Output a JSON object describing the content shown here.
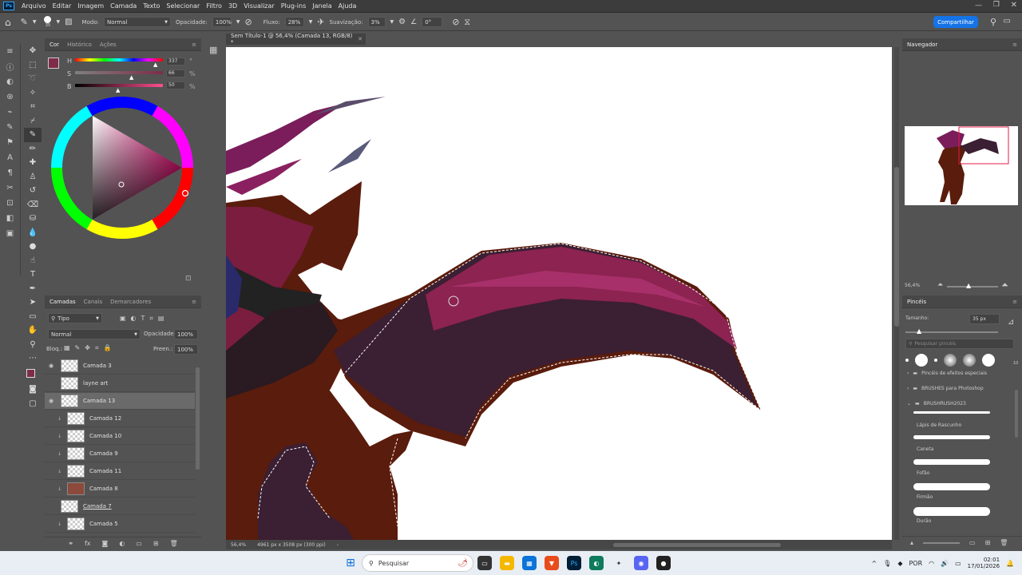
{
  "menu": [
    "Arquivo",
    "Editar",
    "Imagem",
    "Camada",
    "Texto",
    "Selecionar",
    "Filtro",
    "3D",
    "Visualizar",
    "Plug-ins",
    "Janela",
    "Ajuda"
  ],
  "options": {
    "brush_size": "35",
    "mode_label": "Modo:",
    "mode_value": "Normal",
    "opacity_label": "Opacidade:",
    "opacity_value": "100%",
    "flow_label": "Fluxo:",
    "flow_value": "28%",
    "smoothing_label": "Suavização:",
    "smoothing_value": "3%",
    "angle_value": "0°",
    "share_label": "Compartilhar"
  },
  "color_panel": {
    "tabs": [
      "Cor",
      "Histórico",
      "Ações"
    ],
    "h_label": "H",
    "h_value": "337",
    "h_unit": "°",
    "s_label": "S",
    "s_value": "66",
    "s_unit": "%",
    "b_label": "B",
    "b_value": "50",
    "b_unit": "%",
    "fg_color": "#7f2b4a",
    "bg_color": "#ffffff"
  },
  "layers_panel": {
    "tabs": [
      "Camadas",
      "Canais",
      "Demarcadores"
    ],
    "filter_label": "Tipo",
    "blend_mode": "Normal",
    "opacity_label": "Opacidade:",
    "opacity_value": "100%",
    "lock_label": "Bloq.:",
    "fill_label": "Preen.:",
    "fill_value": "100%",
    "layers": [
      {
        "name": "Camada 3",
        "visible": true,
        "selected": false,
        "clipped": false
      },
      {
        "name": "layne art",
        "visible": false,
        "selected": false,
        "clipped": false
      },
      {
        "name": "Camada 13",
        "visible": true,
        "selected": true,
        "clipped": false
      },
      {
        "name": "Camada 12",
        "visible": false,
        "selected": false,
        "clipped": true
      },
      {
        "name": "Camada 10",
        "visible": false,
        "selected": false,
        "clipped": true
      },
      {
        "name": "Camada 9",
        "visible": false,
        "selected": false,
        "clipped": true
      },
      {
        "name": "Camada 11",
        "visible": false,
        "selected": false,
        "clipped": true
      },
      {
        "name": "Camada 8",
        "visible": false,
        "selected": false,
        "clipped": true
      },
      {
        "name": "Camada 7",
        "visible": false,
        "selected": false,
        "clipped": false
      },
      {
        "name": "Camada 5",
        "visible": false,
        "selected": false,
        "clipped": true
      }
    ]
  },
  "document": {
    "tab_title": "Sem Título-1 @ 56,4% (Camada 13, RGB/8) *",
    "zoom": "56,4%",
    "dimensions": "4961 px x 3508 px (300 ppi)"
  },
  "navigator": {
    "title": "Navegador",
    "zoom": "56,4%"
  },
  "brushes_panel": {
    "title": "Pincéis",
    "size_label": "Tamanho:",
    "size_value": "35 px",
    "search_placeholder": "Pesquisar pincéis",
    "preset_number": "10",
    "folders": [
      "Pincéis de efeitos especiais",
      "BRUSHES para Photoshop",
      "BRUSHRUSH2023"
    ],
    "brushes": [
      "Lápis de Rascunho",
      "Caneta",
      "Fofão",
      "Firmão",
      "Durão"
    ]
  },
  "taskbar": {
    "search_label": "Pesquisar",
    "lang": "POR",
    "time": "02:01",
    "date": "17/01/2026"
  }
}
